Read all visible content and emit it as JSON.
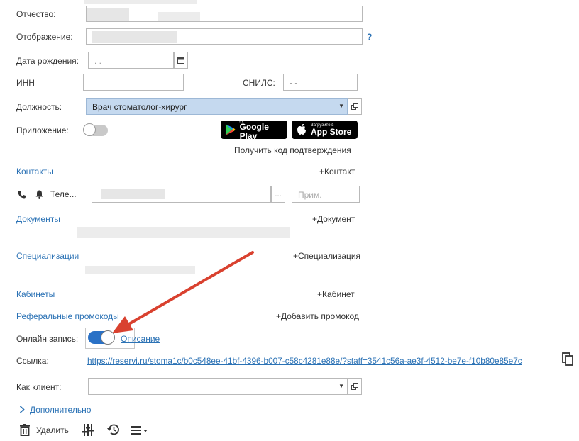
{
  "form": {
    "patronymic_label": "Отчество:",
    "display_label": "Отображение:",
    "display_help": "?",
    "birthdate_label": "Дата рождения:",
    "birthdate_value": ". .",
    "inn_label": "ИНН",
    "snils_label": "СНИЛС:",
    "snils_value": "-  -",
    "position_label": "Должность:",
    "position_value": "Врач стоматолог-хирург",
    "app_label": "Приложение:",
    "google_play_small": "ДОСТУПНО В",
    "google_play_big": "Google Play",
    "app_store_small": "Загрузите в",
    "app_store_big": "App Store",
    "get_code_label": "Получить код подтверждения"
  },
  "sections": {
    "contacts_label": "Контакты",
    "add_contact": "+Контакт",
    "phone_label": "Теле...",
    "phone_dots": "...",
    "note_placeholder": "Прим.",
    "documents_label": "Документы",
    "add_document": "+Документ",
    "specializations_label": "Специализации",
    "add_specialization": "+Специализация",
    "cabinets_label": "Кабинеты",
    "add_cabinet": "+Кабинет",
    "promo_label": "Реферальные промокоды",
    "add_promo": "+Добавить промокод"
  },
  "online": {
    "label": "Онлайн запись:",
    "enabled": true,
    "description_link": "Описание",
    "link_label": "Ссылка:",
    "link_url": "https://reservi.ru/stoma1c/b0c548ee-41bf-4396-b007-c58c4281e88e/?staff=3541c56a-ae3f-4512-be7e-f10b80e85e7c",
    "client_label": "Как клиент:"
  },
  "footer": {
    "more_label": "Дополнительно",
    "delete_label": "Удалить"
  },
  "colors": {
    "link": "#2b72b5",
    "toggle_on": "#2a71c6",
    "position_bg": "#c5d9ef",
    "arrow": "#d9412f"
  },
  "icons": [
    "calendar-icon",
    "dropdown-arrow-icon",
    "open-icon",
    "phone-icon",
    "bell-icon",
    "copy-icon",
    "chevron-right-icon",
    "trash-icon",
    "settings-sliders-icon",
    "history-icon",
    "menu-icon",
    "apple-icon",
    "google-play-icon"
  ]
}
